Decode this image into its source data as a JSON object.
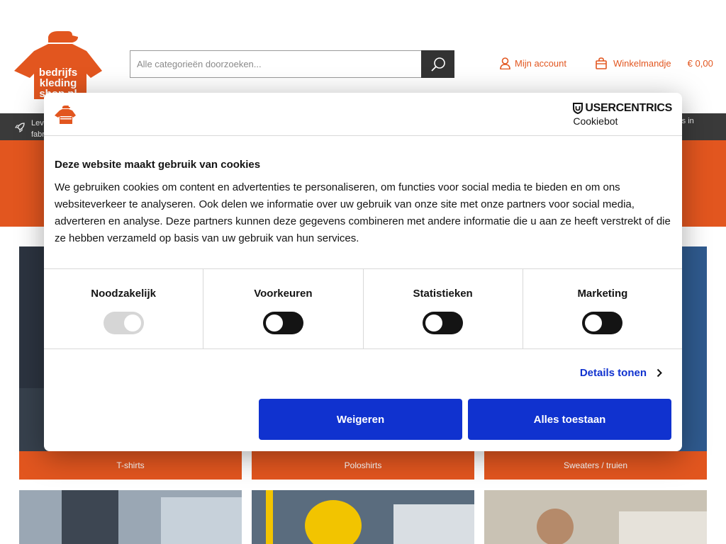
{
  "header": {
    "logo_text": [
      "bedrijfs",
      "kleding",
      "shop.nl"
    ],
    "search_placeholder": "Alle categorieën doorzoeken...",
    "account_label": "Mijn account",
    "cart_label": "Winkelmandje",
    "cart_total": "€ 0,00",
    "brand_color": "#e2561f"
  },
  "usp_bar": {
    "left_text": "Leve fabr",
    "right_text": "rs in"
  },
  "categories": [
    {
      "label": "T-shirts"
    },
    {
      "label": "Poloshirts"
    },
    {
      "label": "Sweaters / truien"
    }
  ],
  "cookie_dialog": {
    "brand": "USERCENTRICS",
    "brand_sub": "Cookiebot",
    "title": "Deze website maakt gebruik van cookies",
    "text": "We gebruiken cookies om content en advertenties te personaliseren, om functies voor social media te bieden en om ons websiteverkeer te analyseren. Ook delen we informatie over uw gebruik van onze site met onze partners voor social media, adverteren en analyse. Deze partners kunnen deze gegevens combineren met andere informatie die u aan ze heeft verstrekt of die ze hebben verzameld op basis van uw gebruik van hun services.",
    "toggles": [
      {
        "label": "Noodzakelijk",
        "state": "on-disabled"
      },
      {
        "label": "Voorkeuren",
        "state": "off"
      },
      {
        "label": "Statistieken",
        "state": "off"
      },
      {
        "label": "Marketing",
        "state": "off"
      }
    ],
    "details_label": "Details tonen",
    "decline_label": "Weigeren",
    "accept_label": "Alles toestaan",
    "button_color": "#1032cf"
  }
}
